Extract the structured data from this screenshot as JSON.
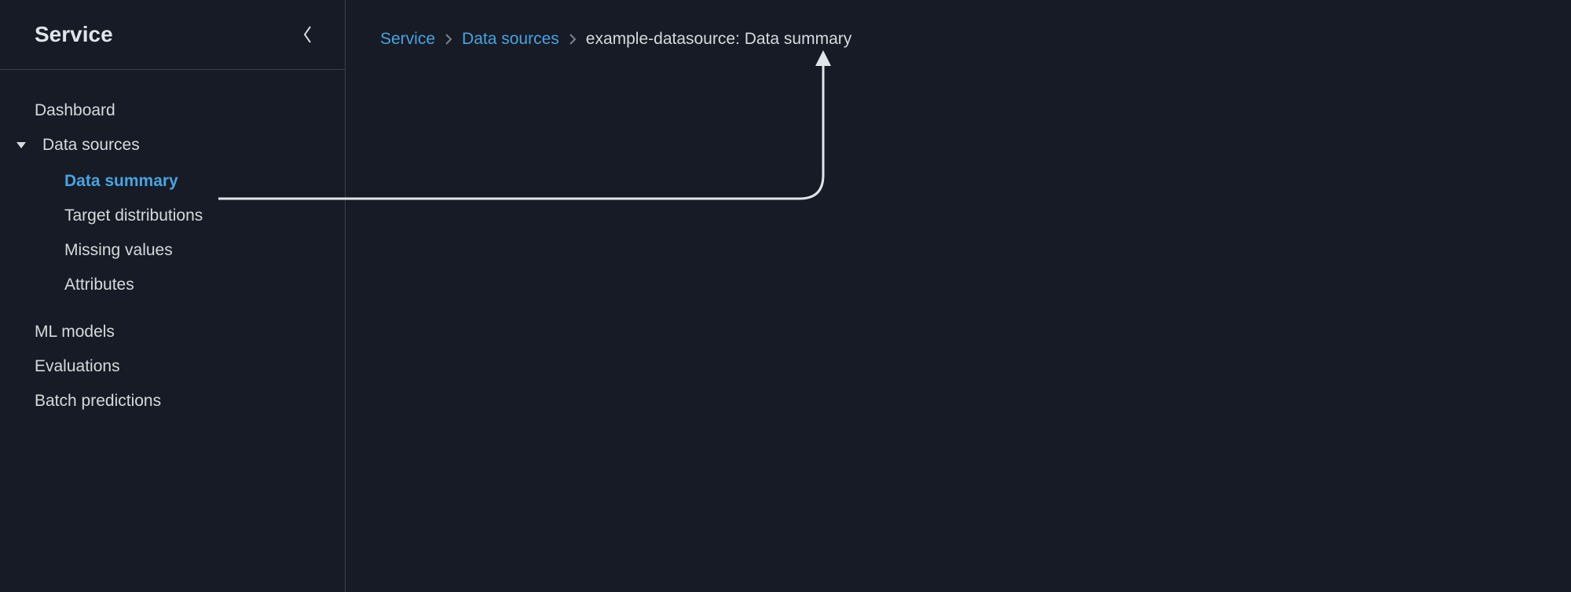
{
  "sidebar": {
    "title": "Service",
    "collapse_icon": "chevron-left",
    "items": [
      {
        "label": "Dashboard",
        "hasChildren": false
      },
      {
        "label": "Data sources",
        "hasChildren": true,
        "expanded": true,
        "children": [
          {
            "label": "Data summary",
            "active": true
          },
          {
            "label": "Target distributions",
            "active": false
          },
          {
            "label": "Missing values",
            "active": false
          },
          {
            "label": "Attributes",
            "active": false
          }
        ]
      },
      {
        "label": "ML models",
        "hasChildren": false
      },
      {
        "label": "Evaluations",
        "hasChildren": false
      },
      {
        "label": "Batch predictions",
        "hasChildren": false
      }
    ]
  },
  "breadcrumb": {
    "segments": [
      {
        "label": "Service",
        "link": true
      },
      {
        "label": "Data sources",
        "link": true
      },
      {
        "label": "example-datasource: Data summary",
        "link": false
      }
    ]
  },
  "colors": {
    "background": "#161b26",
    "text": "#d5dbdb",
    "accent": "#4aa3df",
    "border": "#3a3f4a"
  }
}
